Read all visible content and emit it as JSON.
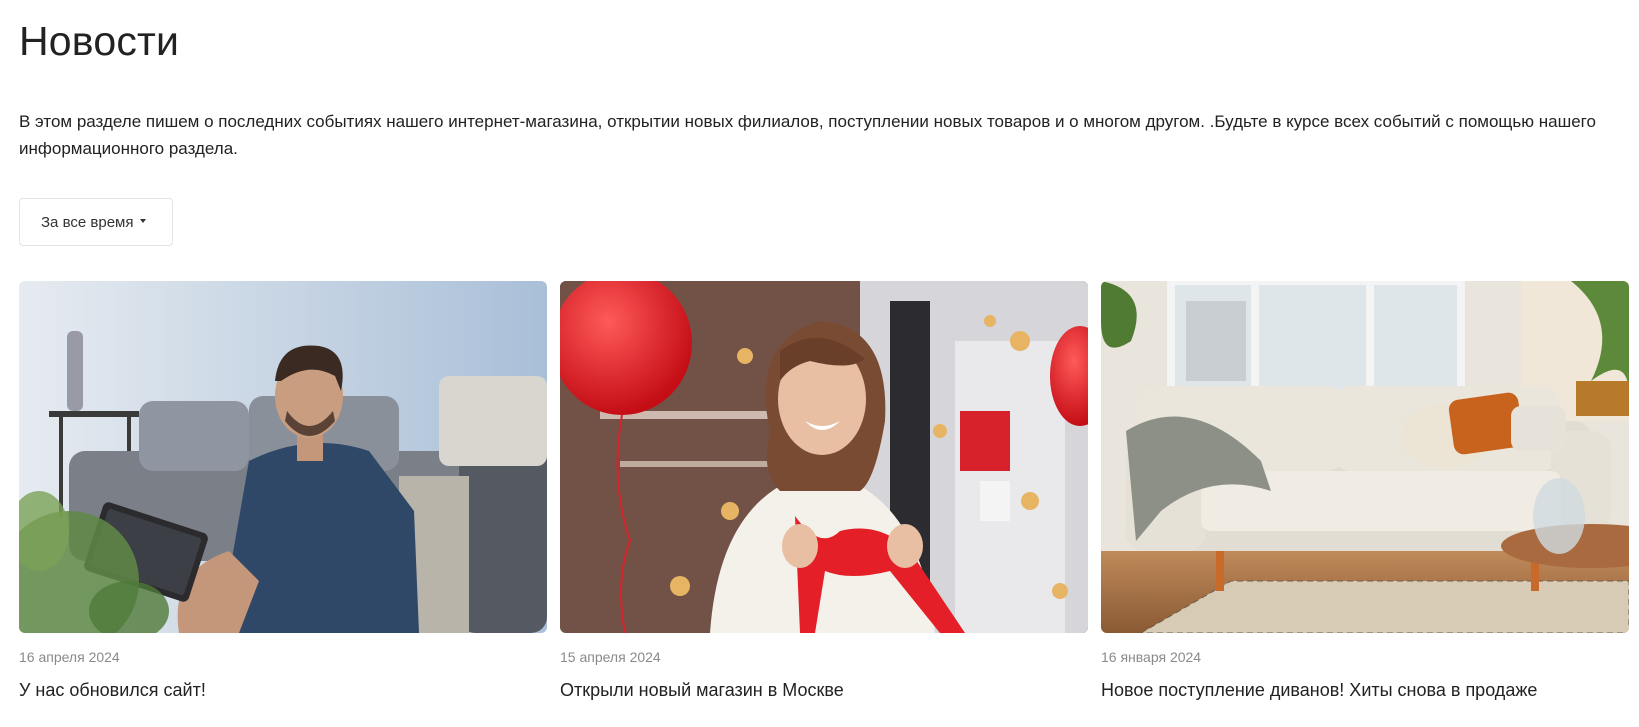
{
  "page": {
    "title": "Новости",
    "intro": "В этом разделе пишем о последних событиях нашего интернет-магазина, открытии новых филиалов, поступлении новых товаров и о многом другом. .Будьте в курсе всех событий с помощью нашего информационного раздела."
  },
  "filter": {
    "label": "За все время",
    "icon": "caret-down-icon"
  },
  "news": [
    {
      "date": "16 апреля 2024",
      "title": "У нас обновился сайт!",
      "image": "man-with-tablet-on-sofa"
    },
    {
      "date": "15 апреля 2024",
      "title": "Открыли новый магазин в Москве",
      "image": "woman-with-red-ribbon-and-balloons"
    },
    {
      "date": "16 января 2024",
      "title": "Новое поступление диванов! Хиты снова в продаже",
      "image": "beige-sofa-in-living-room"
    }
  ],
  "colors": {
    "text": "#222222",
    "muted": "#8a8a8a",
    "border": "#e3e3e3",
    "accent_red": "#d8222b"
  }
}
